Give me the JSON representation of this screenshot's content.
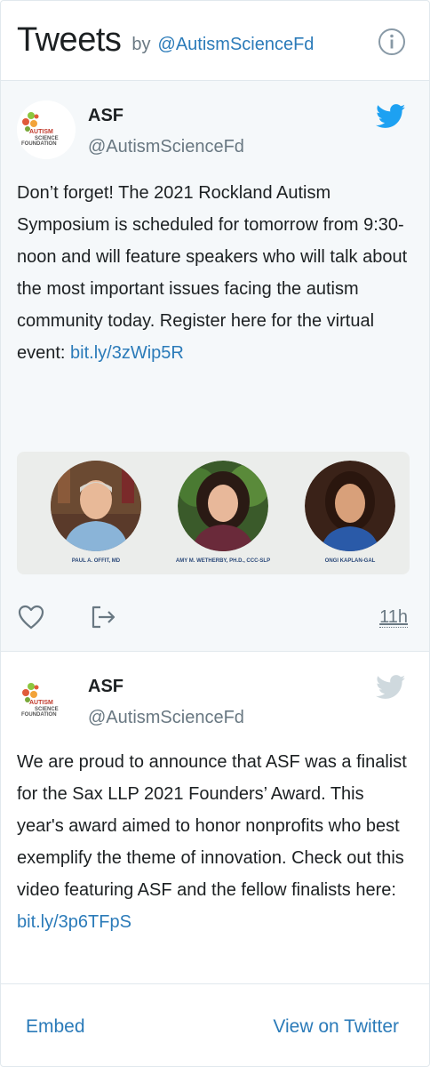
{
  "header": {
    "title": "Tweets",
    "by": "by",
    "handle": "@AutismScienceFd",
    "info_icon": "info-circle-icon"
  },
  "avatar_logo": {
    "line1": "AUTISM",
    "line2": "SCIENCE",
    "line3": "FOUNDATION"
  },
  "tweets": [
    {
      "name": "ASF",
      "handle": "@AutismScienceFd",
      "text": "Don’t forget! The 2021 Rockland Autism Symposium is scheduled for tomorrow from 9:30-noon and will feature speakers who will talk about the most important issues facing the autism community today. Register here for the virtual event: ",
      "link": "bit.ly/3zWip5R",
      "media": {
        "speakers": [
          {
            "caption": "PAUL A. OFFIT, MD"
          },
          {
            "caption": "AMY M. WETHERBY, PH.D., CCC-SLP"
          },
          {
            "caption": "ONGI KAPLAN-GAL"
          }
        ]
      },
      "timestamp": "11h",
      "bird_color": "#1da1f2"
    },
    {
      "name": "ASF",
      "handle": "@AutismScienceFd",
      "text": "We are proud to announce that ASF was a finalist for the Sax LLP 2021 Founders’ Award. This year's award aimed to honor nonprofits who best exemplify the theme of innovation. Check out this video featuring ASF and the fellow finalists here: ",
      "link": "bit.ly/3p6TFpS",
      "bird_color": "#cfd9de"
    }
  ],
  "footer": {
    "embed": "Embed",
    "view": "View on Twitter"
  },
  "colors": {
    "link": "#2b7bb9",
    "muted": "#697882",
    "first_tweet_bg": "#f5f8fa",
    "twitter_blue": "#1da1f2"
  }
}
